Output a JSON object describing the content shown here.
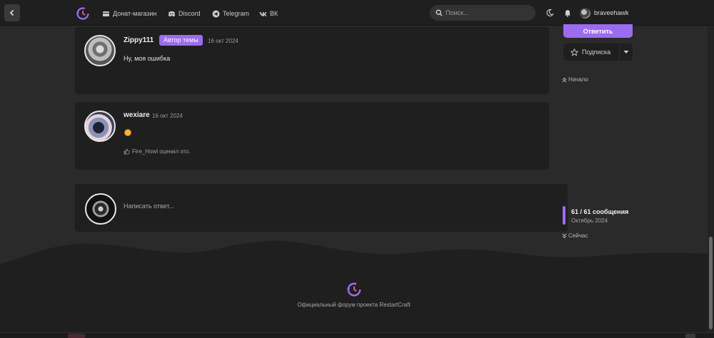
{
  "header": {
    "nav": [
      {
        "label": "Донат-магазин",
        "icon": "store-icon"
      },
      {
        "label": "Discord",
        "icon": "discord-icon"
      },
      {
        "label": "Telegram",
        "icon": "telegram-icon"
      },
      {
        "label": "ВК",
        "icon": "vk-icon"
      }
    ],
    "search_placeholder": "Поиск...",
    "username": "braveehawk"
  },
  "posts": [
    {
      "author": "Zippy111",
      "badge": "Автор темы",
      "date": "16 окт 2024",
      "text": "Ну, моя ошибка"
    },
    {
      "author": "wexiare",
      "date": "16 окт 2024",
      "emoji": "grinning-emoji-icon",
      "liked": "Fire_Howl оценил это."
    }
  ],
  "reply": {
    "placeholder": "Написать ответ..."
  },
  "sidebar": {
    "answer_label": "Ответить",
    "subscribe_label": "Подписка",
    "top_link": "Начало",
    "progress_count": "61 / 61 сообщения",
    "progress_date": "Октябрь 2024",
    "bottom_link": "Сейчас"
  },
  "footer": {
    "text": "Официальный форум проекта RestartCraft"
  },
  "colors": {
    "accent": "#9b6cf0",
    "panel": "#1f1f1f",
    "background": "#2a2a2a"
  }
}
